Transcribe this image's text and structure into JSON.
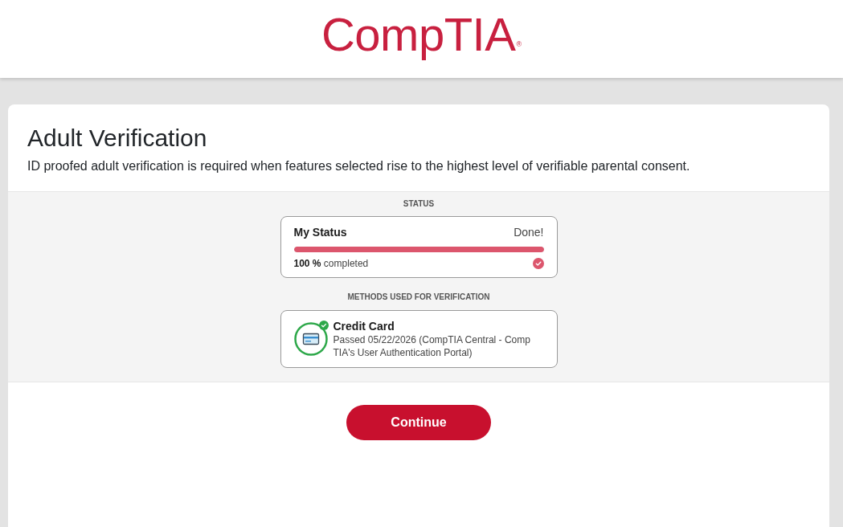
{
  "header": {
    "logo": {
      "text": "CompTIA",
      "mark": "®"
    }
  },
  "card": {
    "title": "Adult Verification",
    "description": "ID proofed adult verification is required when features selected rise to the highest level of verifiable parental consent.",
    "status": {
      "label": "STATUS",
      "heading": "My Status",
      "state": "Done!",
      "level": 1,
      "progress_text": "**100 %** completed",
      "complete": true
    },
    "methods": {
      "label": "METHODS USED FOR VERIFICATION",
      "items": [
        {
          "kind": "credit_card",
          "name": "Credit Card",
          "detail_lines": [
            "Passed 05/22/2026 (CompTIA Central - Comp",
            "TIA's User Authentication Portal)"
          ],
          "passed": true
        }
      ]
    },
    "buttons": [
      {
        "label": "Continue"
      }
    ]
  }
}
